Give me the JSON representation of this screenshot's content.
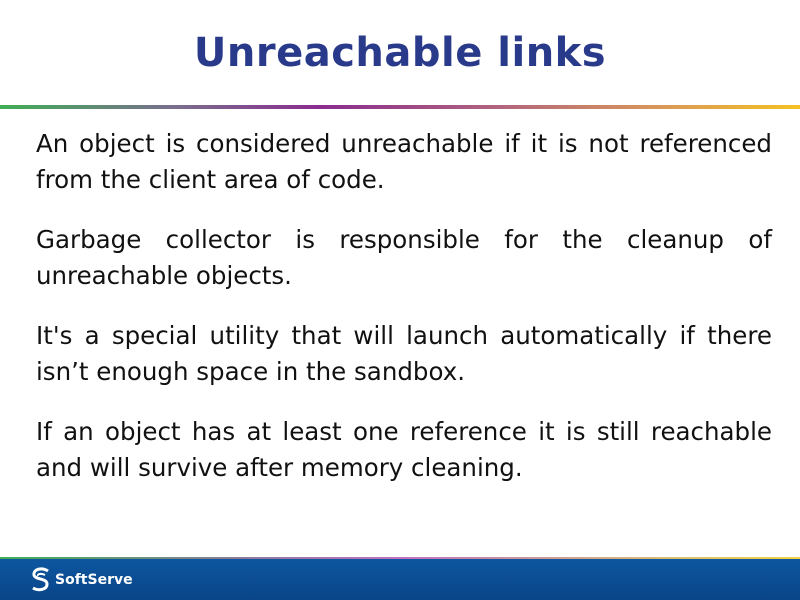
{
  "slide": {
    "title": "Unreachable links",
    "paragraphs": [
      "An object is considered unreachable if it is not referenced from the client area of code.",
      "Garbage collector is responsible for the cleanup of unreachable objects.",
      "It's a special utility that will launch automatically if there isn’t enough space in the sandbox.",
      "If an object has at least one reference it is still reachable and will survive after memory cleaning."
    ]
  },
  "footer": {
    "logo_text": "SoftServe",
    "background": "#0a4a8f"
  },
  "colors": {
    "title": "#2a3a8a"
  }
}
